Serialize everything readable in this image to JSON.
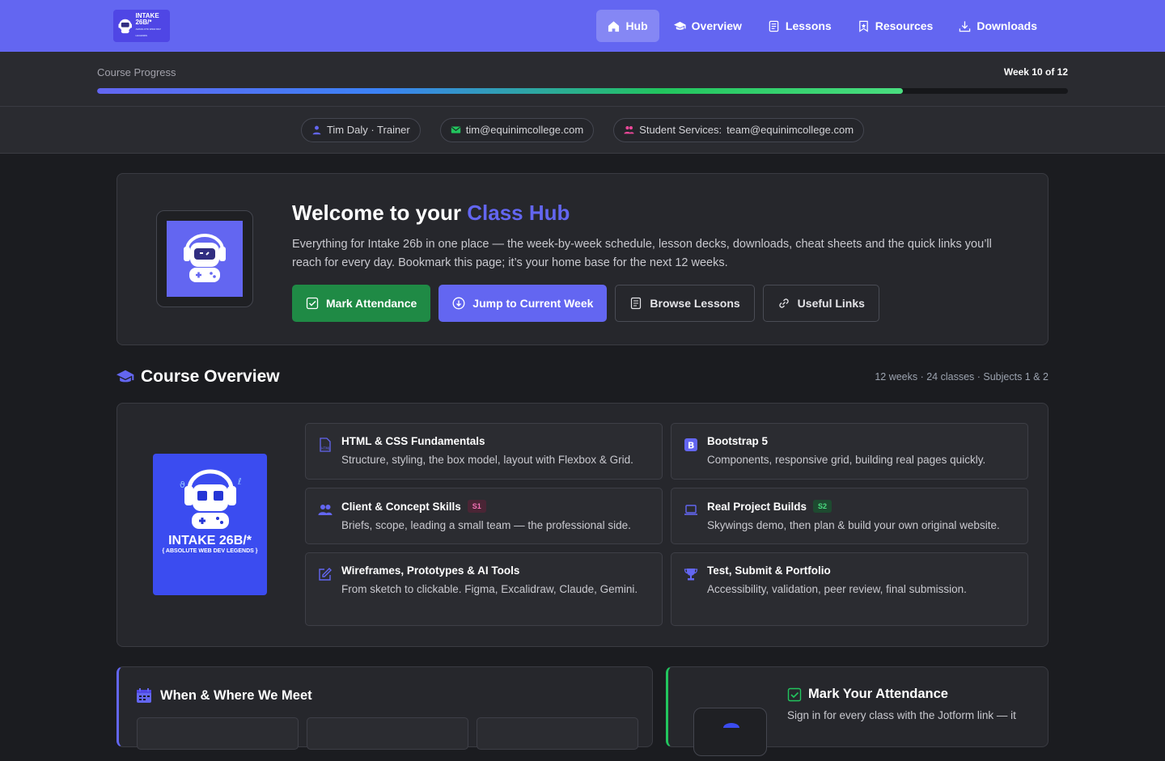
{
  "nav": {
    "logo_line1": "INTAKE",
    "logo_line2": "26B/*",
    "logo_line3": "ABSOLUTE WEB DEV LEGENDS",
    "links": [
      {
        "label": "Hub",
        "icon": "home-icon",
        "active": true
      },
      {
        "label": "Overview",
        "icon": "graduation-cap-icon"
      },
      {
        "label": "Lessons",
        "icon": "document-icon"
      },
      {
        "label": "Resources",
        "icon": "bookmark-icon"
      },
      {
        "label": "Downloads",
        "icon": "download-icon"
      }
    ]
  },
  "progress": {
    "label": "Course Progress",
    "week_text": "Week 10 of 12",
    "fraction": 0.83
  },
  "contacts": {
    "trainer": "Tim Daly · Trainer",
    "email": "tim@equinimcollege.com",
    "services_label": "Student Services:",
    "services_email": "team@equinimcollege.com"
  },
  "hero": {
    "title_prefix": "Welcome to your ",
    "title_accent": "Class Hub",
    "text": "Everything for Intake 26b in one place — the week-by-week schedule, lesson decks, downloads, cheat sheets and the quick links you’ll reach for every day. Bookmark this page; it’s your home base for the next 12 weeks.",
    "buttons": {
      "attendance": "Mark Attendance",
      "jump": "Jump to Current Week",
      "browse": "Browse Lessons",
      "links": "Useful Links"
    }
  },
  "overview": {
    "title": "Course Overview",
    "meta": "12 weeks · 24 classes · Subjects 1 & 2",
    "badge_title": "INTAKE 26B/*",
    "badge_sub": "{ ABSOLUTE WEB DEV LEGENDS }",
    "subjects": [
      {
        "title": "HTML & CSS Fundamentals",
        "desc": "Structure, styling, the box model, layout with Flexbox & Grid.",
        "icon": "html-file-icon",
        "tag": ""
      },
      {
        "title": "Bootstrap 5",
        "desc": "Components, responsive grid, building real pages quickly.",
        "icon": "bootstrap-icon",
        "tag": ""
      },
      {
        "title": "Client & Concept Skills",
        "desc": "Briefs, scope, leading a small team — the professional side.",
        "icon": "people-icon",
        "tag": "S1"
      },
      {
        "title": "Real Project Builds",
        "desc": "Skywings demo, then plan & build your own original website.",
        "icon": "laptop-icon",
        "tag": "S2"
      },
      {
        "title": "Wireframes, Prototypes & AI Tools",
        "desc": "From sketch to clickable. Figma, Excalidraw, Claude, Gemini.",
        "icon": "edit-icon",
        "tag": ""
      },
      {
        "title": "Test, Submit & Portfolio",
        "desc": "Accessibility, validation, peer review, final submission.",
        "icon": "trophy-icon",
        "tag": ""
      }
    ]
  },
  "meet": {
    "title": "When & Where We Meet"
  },
  "attendance": {
    "title": "Mark Your Attendance",
    "text": "Sign in for every class with the Jotform link — it"
  },
  "colors": {
    "accent": "#6366f1",
    "green": "#1f8a45",
    "background": "#1b1c20"
  }
}
